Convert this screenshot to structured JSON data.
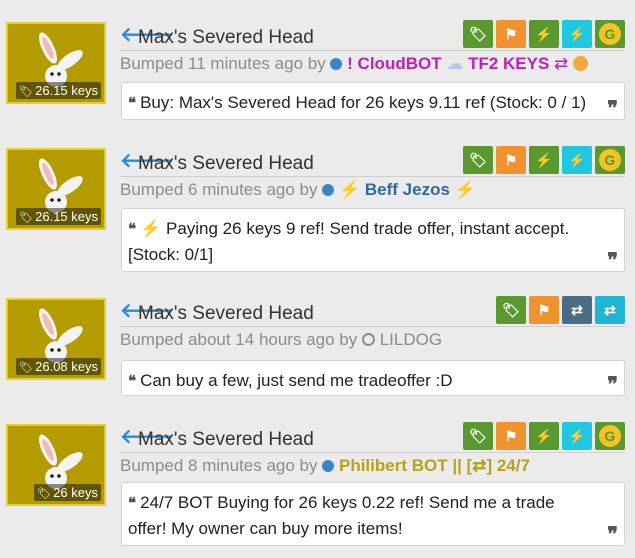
{
  "listings": [
    {
      "item_name": "Max's Severed Head",
      "price_tag": "26.15 keys",
      "bump_prefix": "Bumped 11 minutes ago by",
      "username": "! CloudBOT",
      "username_suffix": "TF2 KEYS",
      "username_color": "#c21fb4",
      "message": "Buy: Max's Severed Head for 26 keys 9.11 ref (Stock: 0 / 1)",
      "buttons": [
        "tag-icon",
        "flag-icon",
        "bolt-icon",
        "bolt-icon",
        "g-icon"
      ]
    },
    {
      "item_name": "Max's Severed Head",
      "price_tag": "26.15 keys",
      "bump_prefix": "Bumped 6 minutes ago by",
      "username": "Beff Jezos",
      "username_color": "#2f6a9d",
      "message": "Paying 26 keys 9 ref! Send trade offer, instant accept. [Stock: 0/1]",
      "buttons": [
        "tag-icon",
        "flag-icon",
        "bolt-icon",
        "bolt-icon",
        "g-icon"
      ]
    },
    {
      "item_name": "Max's Severed Head",
      "price_tag": "26.08 keys",
      "bump_prefix": "Bumped about 14 hours ago by",
      "username": "LILDOG",
      "username_color": "#8c8c8c",
      "message": "Can buy a few, just send me tradeoffer :D",
      "buttons": [
        "tag-icon",
        "flag-icon",
        "swap-icon",
        "swap-icon"
      ]
    },
    {
      "item_name": "Max's Severed Head",
      "price_tag": "26 keys",
      "bump_prefix": "Bumped 8 minutes ago by",
      "username": "Philibert BOT || [⇄] 24/7",
      "username_color": "#b8a21a",
      "message": "24/7 BOT Buying for 26 keys 0.22 ref! Send me a trade offer! My owner can buy more items!",
      "buttons": [
        "tag-icon",
        "flag-icon",
        "bolt-icon",
        "bolt-icon",
        "g-icon"
      ]
    }
  ]
}
